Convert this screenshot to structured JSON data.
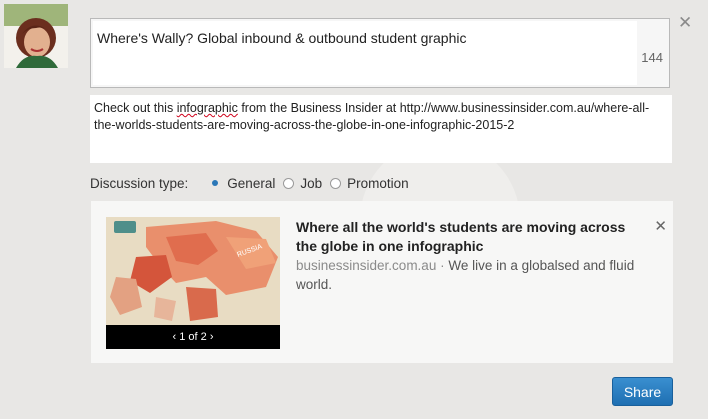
{
  "post": {
    "title": "Where's Wally? Global inbound & outbound student graphic",
    "char_count": "144",
    "message_prefix": "Check out this ",
    "message_flagged_word": "infographic",
    "message_suffix": " from the Business Insider at http://www.businessinsider.com.au/where-all-the-worlds-students-are-moving-across-the-globe-in-one-infographic-2015-2"
  },
  "discussion": {
    "label": "Discussion type:",
    "options": [
      "General",
      "Job",
      "Promotion"
    ],
    "selected": "General"
  },
  "preview": {
    "title": "Where all the world's students are moving across the globe in one infographic",
    "domain": "businessinsider.com.au",
    "separator": " · ",
    "description": "We live in a globalsed and fluid world.",
    "pager": "1 of 2"
  },
  "actions": {
    "share_label": "Share"
  }
}
